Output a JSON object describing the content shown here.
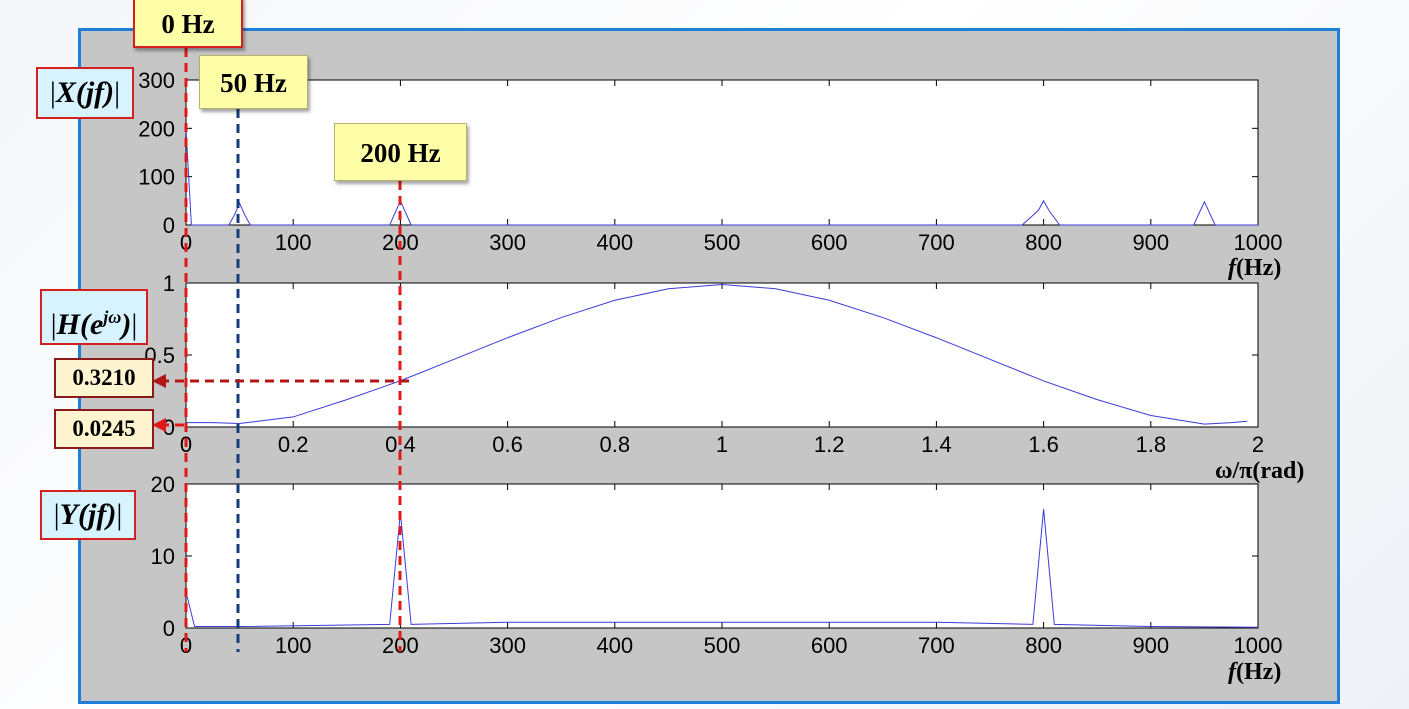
{
  "chart_data": [
    {
      "type": "line",
      "xlabel": "f (Hz)",
      "ylabel": "|X(jf)|",
      "xlim": [
        0,
        1000
      ],
      "ylim": [
        0,
        300
      ],
      "xticks": [
        "0",
        "100",
        "200",
        "300",
        "400",
        "500",
        "600",
        "700",
        "800",
        "900",
        "1000"
      ],
      "yticks": [
        "0",
        "100",
        "200",
        "300"
      ],
      "x": [
        0,
        5,
        10,
        40,
        45,
        50,
        55,
        60,
        190,
        195,
        200,
        205,
        210,
        780,
        795,
        800,
        805,
        815,
        940,
        950,
        960,
        970,
        1000
      ],
      "y": [
        200,
        0,
        0,
        0,
        20,
        45,
        20,
        0,
        0,
        25,
        50,
        25,
        0,
        0,
        30,
        50,
        30,
        0,
        0,
        48,
        0,
        0,
        0
      ]
    },
    {
      "type": "line",
      "xlabel": "ω/π(rad)",
      "ylabel": "|H(e^jω)|",
      "xlim": [
        0,
        2
      ],
      "ylim": [
        0,
        1
      ],
      "xticks": [
        "0",
        "0.2",
        "0.4",
        "0.6",
        "0.8",
        "1",
        "1.2",
        "1.4",
        "1.6",
        "1.8",
        "2"
      ],
      "yticks": [
        "0",
        "0.5",
        "1"
      ],
      "x": [
        0,
        0.05,
        0.1,
        0.2,
        0.3,
        0.4,
        0.5,
        0.6,
        0.7,
        0.8,
        0.9,
        1.0,
        1.1,
        1.2,
        1.3,
        1.4,
        1.5,
        1.6,
        1.7,
        1.8,
        1.9,
        1.95,
        1.98
      ],
      "y": [
        0.03,
        0.03,
        0.0245,
        0.07,
        0.19,
        0.321,
        0.47,
        0.62,
        0.76,
        0.88,
        0.96,
        0.99,
        0.96,
        0.88,
        0.76,
        0.62,
        0.47,
        0.32,
        0.19,
        0.08,
        0.02,
        0.03,
        0.04
      ]
    },
    {
      "type": "line",
      "xlabel": "f (Hz)",
      "ylabel": "|Y(jf)|",
      "xlim": [
        0,
        1000
      ],
      "ylim": [
        0,
        20
      ],
      "xticks": [
        "0",
        "100",
        "200",
        "300",
        "400",
        "500",
        "600",
        "700",
        "800",
        "900",
        "1000"
      ],
      "yticks": [
        "0",
        "10",
        "20"
      ],
      "x": [
        0,
        8,
        50,
        190,
        200,
        210,
        300,
        700,
        790,
        800,
        810,
        900,
        1000
      ],
      "y": [
        5,
        0.2,
        0.2,
        0.5,
        16,
        0.5,
        0.8,
        0.8,
        0.5,
        16.5,
        0.5,
        0.2,
        0.1
      ]
    }
  ],
  "annotations": {
    "hz0": "0 Hz",
    "hz50": "50 Hz",
    "hz200": "200 Hz",
    "val_a": "0.3210",
    "val_b": "0.0245",
    "xlab_top_f": "f",
    "xlab_top_unit": "(Hz)",
    "xlab_mid": "ω/π(rad)",
    "xlab_bot_f": "f",
    "xlab_bot_unit": "(Hz)"
  },
  "colors": {
    "frame_border": "#1e7fd6",
    "frame_fill": "#c6c6c6",
    "trace": "#3b3bd8",
    "red_marker": "#e01818",
    "blue_marker": "#143c78",
    "dark_red_marker": "#b01818"
  }
}
